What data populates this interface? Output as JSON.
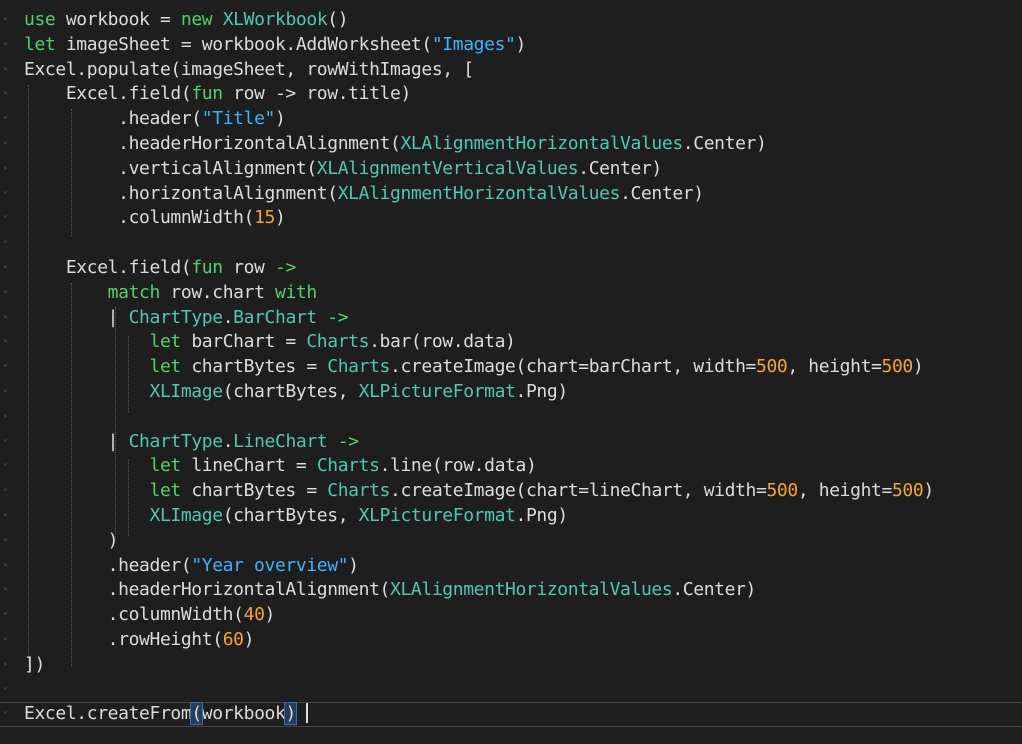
{
  "editor": {
    "background": "#1e1e1e",
    "colors": {
      "keyword": "#4fd463",
      "type": "#4ec9b0",
      "string": "#3bb4ff",
      "number": "#f5a623",
      "plain": "#dcdcdc",
      "whitespace": "#3f3f3f"
    },
    "lines": [
      [
        [
          "kw",
          "use"
        ],
        [
          "pl",
          " workbook = "
        ],
        [
          "kw",
          "new"
        ],
        [
          "pl",
          " "
        ],
        [
          "ty",
          "XLWorkbook"
        ],
        [
          "pl",
          "()"
        ]
      ],
      [
        [
          "kw",
          "let"
        ],
        [
          "pl",
          " imageSheet = workbook.AddWorksheet("
        ],
        [
          "st",
          "\"Images\""
        ],
        [
          "pl",
          ")"
        ]
      ],
      [
        [
          "pl",
          "Excel.populate(imageSheet, rowWithImages, ["
        ]
      ],
      [
        [
          "pl",
          "    Excel.field("
        ],
        [
          "kw",
          "fun"
        ],
        [
          "pl",
          " row -> row.title)"
        ]
      ],
      [
        [
          "pl",
          "         .header("
        ],
        [
          "st",
          "\"Title\""
        ],
        [
          "pl",
          ")"
        ]
      ],
      [
        [
          "pl",
          "         .headerHorizontalAlignment("
        ],
        [
          "ty",
          "XLAlignmentHorizontalValues"
        ],
        [
          "pl",
          ".Center)"
        ]
      ],
      [
        [
          "pl",
          "         .verticalAlignment("
        ],
        [
          "ty",
          "XLAlignmentVerticalValues"
        ],
        [
          "pl",
          ".Center)"
        ]
      ],
      [
        [
          "pl",
          "         .horizontalAlignment("
        ],
        [
          "ty",
          "XLAlignmentHorizontalValues"
        ],
        [
          "pl",
          ".Center)"
        ]
      ],
      [
        [
          "pl",
          "         .columnWidth("
        ],
        [
          "nu",
          "15"
        ],
        [
          "pl",
          ")"
        ]
      ],
      [],
      [
        [
          "pl",
          "    Excel.field("
        ],
        [
          "kw",
          "fun"
        ],
        [
          "pl",
          " row "
        ],
        [
          "kw",
          "->"
        ]
      ],
      [
        [
          "pl",
          "        "
        ],
        [
          "kw",
          "match"
        ],
        [
          "pl",
          " row.chart "
        ],
        [
          "kw",
          "with"
        ]
      ],
      [
        [
          "pl",
          "        | "
        ],
        [
          "ty",
          "ChartType"
        ],
        [
          "pl",
          "."
        ],
        [
          "ty",
          "BarChart"
        ],
        [
          "pl",
          " "
        ],
        [
          "kw",
          "->"
        ]
      ],
      [
        [
          "pl",
          "            "
        ],
        [
          "kw",
          "let"
        ],
        [
          "pl",
          " barChart = "
        ],
        [
          "ty",
          "Charts"
        ],
        [
          "pl",
          ".bar(row.data)"
        ]
      ],
      [
        [
          "pl",
          "            "
        ],
        [
          "kw",
          "let"
        ],
        [
          "pl",
          " chartBytes = "
        ],
        [
          "ty",
          "Charts"
        ],
        [
          "pl",
          ".createImage(chart=barChart, width="
        ],
        [
          "nu",
          "500"
        ],
        [
          "pl",
          ", height="
        ],
        [
          "nu",
          "500"
        ],
        [
          "pl",
          ")"
        ]
      ],
      [
        [
          "pl",
          "            "
        ],
        [
          "ty",
          "XLImage"
        ],
        [
          "pl",
          "(chartBytes, "
        ],
        [
          "ty",
          "XLPictureFormat"
        ],
        [
          "pl",
          ".Png)"
        ]
      ],
      [],
      [
        [
          "pl",
          "        | "
        ],
        [
          "ty",
          "ChartType"
        ],
        [
          "pl",
          "."
        ],
        [
          "ty",
          "LineChart"
        ],
        [
          "pl",
          " "
        ],
        [
          "kw",
          "->"
        ]
      ],
      [
        [
          "pl",
          "            "
        ],
        [
          "kw",
          "let"
        ],
        [
          "pl",
          " lineChart = "
        ],
        [
          "ty",
          "Charts"
        ],
        [
          "pl",
          ".line(row.data)"
        ]
      ],
      [
        [
          "pl",
          "            "
        ],
        [
          "kw",
          "let"
        ],
        [
          "pl",
          " chartBytes = "
        ],
        [
          "ty",
          "Charts"
        ],
        [
          "pl",
          ".createImage(chart=lineChart, width="
        ],
        [
          "nu",
          "500"
        ],
        [
          "pl",
          ", height="
        ],
        [
          "nu",
          "500"
        ],
        [
          "pl",
          ")"
        ]
      ],
      [
        [
          "pl",
          "            "
        ],
        [
          "ty",
          "XLImage"
        ],
        [
          "pl",
          "(chartBytes, "
        ],
        [
          "ty",
          "XLPictureFormat"
        ],
        [
          "pl",
          ".Png)"
        ]
      ],
      [
        [
          "pl",
          "        )"
        ]
      ],
      [
        [
          "pl",
          "        .header("
        ],
        [
          "st",
          "\"Year overview\""
        ],
        [
          "pl",
          ")"
        ]
      ],
      [
        [
          "pl",
          "        .headerHorizontalAlignment("
        ],
        [
          "ty",
          "XLAlignmentHorizontalValues"
        ],
        [
          "pl",
          ".Center)"
        ]
      ],
      [
        [
          "pl",
          "        .columnWidth("
        ],
        [
          "nu",
          "40"
        ],
        [
          "pl",
          ")"
        ]
      ],
      [
        [
          "pl",
          "        .rowHeight("
        ],
        [
          "nu",
          "60"
        ],
        [
          "pl",
          ")"
        ]
      ],
      [
        [
          "pl",
          "])"
        ]
      ],
      [],
      [
        [
          "pl",
          "Excel.createFrom"
        ],
        [
          "pl",
          "("
        ],
        [
          "pl",
          "workbook"
        ],
        [
          "pl",
          ")"
        ]
      ]
    ]
  }
}
